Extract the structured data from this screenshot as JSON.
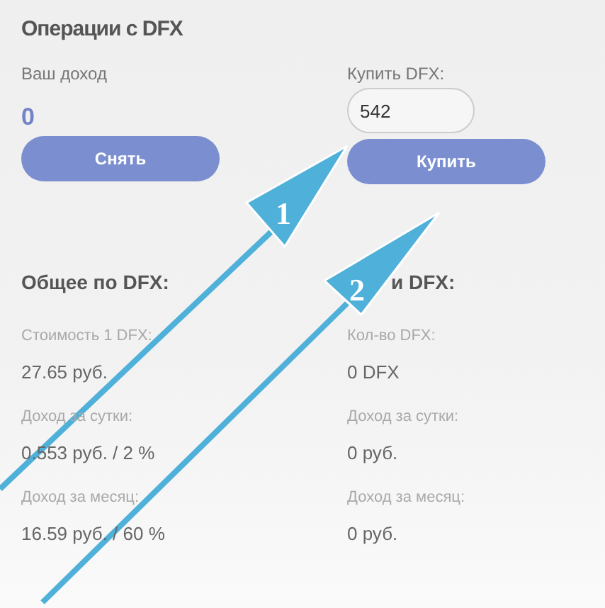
{
  "title": "Операции с DFX",
  "income": {
    "label": "Ваш доход",
    "value": "0",
    "button": "Снять"
  },
  "buy": {
    "label": "Купить DFX:",
    "input_value": "542",
    "button": "Купить"
  },
  "general": {
    "heading": "Общее по DFX:",
    "rows": [
      {
        "label": "Стоимость 1 DFX:",
        "value": "27.65 руб."
      },
      {
        "label": "Доход за сутки:",
        "value": "0.553 руб. / 2 %"
      },
      {
        "label": "Доход за месяц:",
        "value": "16.59 руб. / 60 %"
      }
    ]
  },
  "mine": {
    "heading": "и DFX:",
    "rows": [
      {
        "label": "Кол-во DFX:",
        "value": "0 DFX"
      },
      {
        "label": "Доход за сутки:",
        "value": "0 руб."
      },
      {
        "label": "Доход за месяц:",
        "value": "0 руб."
      }
    ]
  },
  "annotations": [
    {
      "number": "1"
    },
    {
      "number": "2"
    }
  ]
}
